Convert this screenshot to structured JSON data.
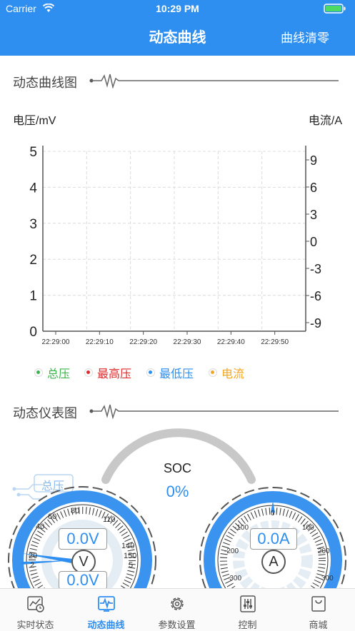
{
  "status": {
    "carrier": "Carrier",
    "time": "10:29 PM"
  },
  "nav": {
    "title": "动态曲线",
    "right": "曲线清零"
  },
  "curve_section": {
    "title": "动态曲线图"
  },
  "gauge_section": {
    "title": "动态仪表图"
  },
  "colors": {
    "accent": "#2f8ff0",
    "green": "#3ab54a",
    "red": "#e02b2b",
    "blue": "#2f8ff0",
    "orange": "#f5a623"
  },
  "chart_data": {
    "type": "line",
    "ylabel": "电压/mV",
    "y2label": "电流/A",
    "ylim": [
      0,
      5
    ],
    "y2lim": [
      -9,
      9
    ],
    "yticks": [
      "0",
      "1",
      "2",
      "3",
      "4",
      "5"
    ],
    "y2ticks": [
      "9",
      "6",
      "3",
      "0",
      "-3",
      "-6",
      "-9"
    ],
    "xticks": [
      "22:29:00",
      "22:29:10",
      "22:29:20",
      "22:29:30",
      "22:29:40",
      "22:29:50"
    ],
    "grid": true,
    "series": [
      {
        "name": "总压",
        "color": "#3ab54a",
        "values": []
      },
      {
        "name": "最高压",
        "color": "#e02b2b",
        "values": []
      },
      {
        "name": "最低压",
        "color": "#2f8ff0",
        "values": []
      },
      {
        "name": "电流",
        "color": "#f5a623",
        "values": []
      }
    ]
  },
  "soc": {
    "label": "SOC",
    "value": "0%"
  },
  "voltage_gauge": {
    "tag": "总压",
    "value1": "0.0V",
    "value2": "0.0V",
    "unit": "V",
    "ticks": [
      "20",
      "40",
      "60",
      "80",
      "110",
      "140",
      "150"
    ],
    "inner_ticks": [
      "2",
      "5"
    ]
  },
  "current_gauge": {
    "value": "0.0A",
    "unit": "A",
    "ticks": [
      "0",
      "100",
      "-100",
      "200",
      "-200",
      "300",
      "-300"
    ]
  },
  "tabs": [
    {
      "label": "实时状态",
      "icon": "chart-icon"
    },
    {
      "label": "动态曲线",
      "icon": "pulse-icon"
    },
    {
      "label": "参数设置",
      "icon": "gear-icon"
    },
    {
      "label": "控制",
      "icon": "sliders-icon"
    },
    {
      "label": "商城",
      "icon": "bag-icon"
    }
  ]
}
